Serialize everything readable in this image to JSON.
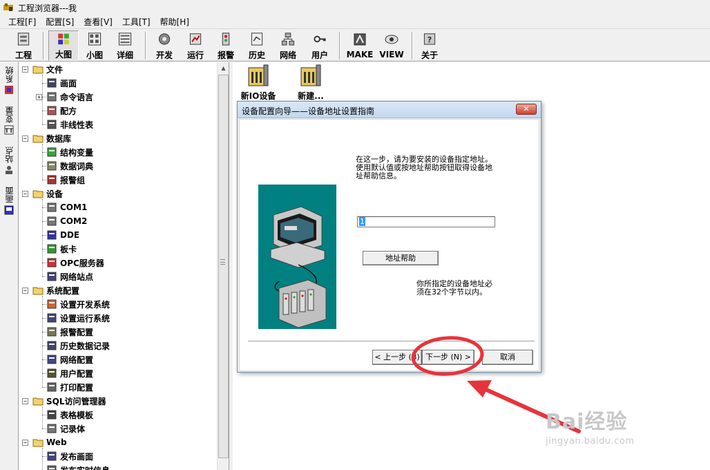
{
  "window": {
    "title": "工程浏览器---我"
  },
  "menu": [
    "工程[F]",
    "配置[S]",
    "查看[V]",
    "工具[T]",
    "帮助[H]"
  ],
  "toolbar": {
    "project": "工程",
    "large_icon": "大图",
    "small_icon": "小图",
    "details": "详细",
    "develop": "开发",
    "run": "运行",
    "alarm": "报警",
    "history": "历史",
    "network": "网络",
    "user": "用户",
    "make": "MAKE",
    "view": "VIEW",
    "about": "关于"
  },
  "side_tabs": [
    "系统",
    "变量",
    "站点",
    "画面"
  ],
  "tree": [
    {
      "label": "文件",
      "expander": "−"
    },
    {
      "label": "画面"
    },
    {
      "label": "命令语言",
      "expander": "+"
    },
    {
      "label": "配方"
    },
    {
      "label": "非线性表"
    },
    {
      "label": "数据库",
      "expander": "−"
    },
    {
      "label": "结构变量"
    },
    {
      "label": "数据词典"
    },
    {
      "label": "报警组"
    },
    {
      "label": "设备",
      "expander": "−"
    },
    {
      "label": "COM1"
    },
    {
      "label": "COM2"
    },
    {
      "label": "DDE"
    },
    {
      "label": "板卡"
    },
    {
      "label": "OPC服务器"
    },
    {
      "label": "网络站点"
    },
    {
      "label": "系统配置",
      "expander": "−"
    },
    {
      "label": "设置开发系统"
    },
    {
      "label": "设置运行系统"
    },
    {
      "label": "报警配置"
    },
    {
      "label": "历史数据记录"
    },
    {
      "label": "网络配置"
    },
    {
      "label": "用户配置"
    },
    {
      "label": "打印配置"
    },
    {
      "label": "SQL访问管理器",
      "expander": "−"
    },
    {
      "label": "表格模板"
    },
    {
      "label": "记录体"
    },
    {
      "label": "Web",
      "expander": "−"
    },
    {
      "label": "发布画面"
    },
    {
      "label": "发布实时信息"
    }
  ],
  "content_items": [
    {
      "label": "新IO设备"
    },
    {
      "label": "新建..."
    }
  ],
  "dialog": {
    "title": "设备配置向导——设备地址设置指南",
    "close": "✕",
    "instruction_lines": [
      "在这一步，请为要安装的设备指定地址。",
      "使用默认值或按地址帮助按钮取得设备地",
      "址帮助信息。"
    ],
    "address_value": "1",
    "help_button": "地址帮助",
    "note_lines": [
      "你所指定的设备地址必",
      "须在32个字节以内。"
    ],
    "back_button": "< 上一步 (B)",
    "next_button": "下一步 (N) >",
    "cancel_button": "取消"
  },
  "annotation": {
    "color": "#e8333b"
  },
  "watermark": {
    "main": "Bai经验",
    "sub": "jingyan.baidu.com"
  }
}
